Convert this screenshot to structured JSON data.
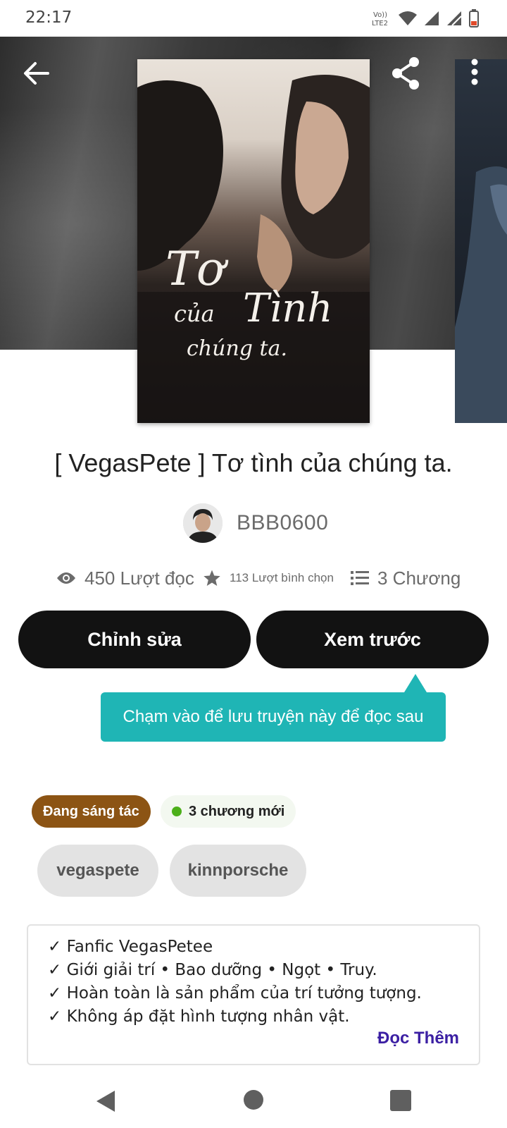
{
  "status_bar": {
    "time": "22:17",
    "icons": [
      "volte-icon",
      "wifi-icon",
      "signal-icon",
      "signal-icon-2",
      "battery-icon"
    ],
    "volte_text_1": "Vo))",
    "volte_text_2": "LTE2"
  },
  "hero": {
    "icons": [
      "back-arrow-icon",
      "share-icon",
      "more-vert-icon"
    ],
    "cover": {
      "title_line_1": "Tơ",
      "title_line_2": "của",
      "title_line_3": "Tình",
      "title_line_4": "chúng ta."
    }
  },
  "story": {
    "title": "[ VegasPete ] Tơ tình của chúng ta.",
    "author": "BBB0600",
    "stats": {
      "reads": "450 Lượt đọc",
      "votes": "113 Lượt bình chọn",
      "parts": "3 Chương"
    }
  },
  "actions": {
    "edit_label": "Chỉnh sửa",
    "preview_label": "Xem trước"
  },
  "tooltip": {
    "text": "Chạm vào để lưu truyện này để đọc sau"
  },
  "badges": {
    "status": "Đang sáng tác",
    "new_parts": "3 chương mới"
  },
  "tags": [
    "vegaspete",
    "kinnporsche"
  ],
  "description": {
    "lines": [
      "✓ Fanfic VegasPetee",
      "✓ Giới giải trí • Bao dưỡng • Ngọt • Truy.",
      "✓ Hoàn toàn là sản phẩm của trí tưởng tượng.",
      "✓ Không áp đặt hình tượng nhân vật."
    ],
    "read_more": "Đọc Thêm"
  },
  "colors": {
    "button_bg": "#121212",
    "tooltip_bg": "#1fb5b5",
    "status_badge_bg": "#8c5414",
    "read_more": "#3b1fa3",
    "new_dot": "#4caf1a"
  },
  "nav_bar": {
    "icons": [
      "nav-back-icon",
      "nav-home-icon",
      "nav-recents-icon"
    ]
  }
}
